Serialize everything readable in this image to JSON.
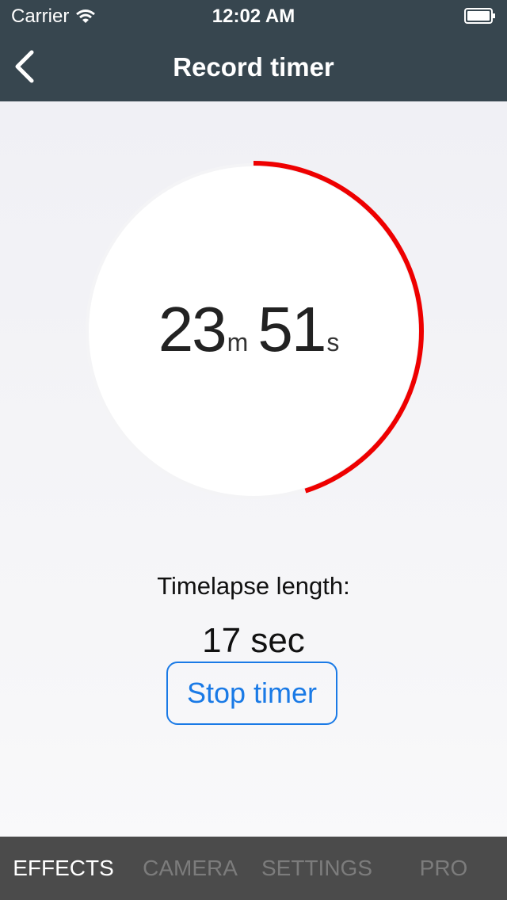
{
  "status_bar": {
    "carrier": "Carrier",
    "time": "12:02 AM"
  },
  "nav": {
    "title": "Record timer",
    "back_icon": "chevron-left-icon"
  },
  "timer": {
    "minutes": "23",
    "minutes_unit": "m",
    "seconds": "51",
    "seconds_unit": "s",
    "progress_fraction": 0.45,
    "progress_color": "#ee0000"
  },
  "timelapse": {
    "label": "Timelapse length:",
    "value": "17 sec"
  },
  "stop_button": {
    "label": "Stop timer",
    "color": "#1a7ae6"
  },
  "tabs": [
    {
      "label": "EFFECTS",
      "active": true
    },
    {
      "label": "CAMERA",
      "active": false
    },
    {
      "label": "SETTINGS",
      "active": false
    },
    {
      "label": "PRO",
      "active": false
    }
  ]
}
